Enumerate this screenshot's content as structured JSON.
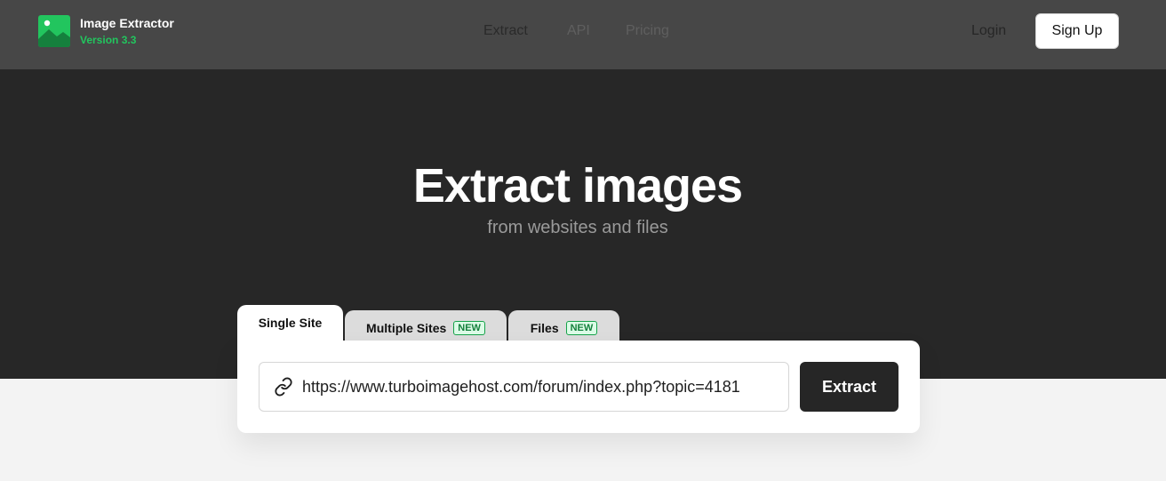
{
  "header": {
    "brand_name": "Image Extractor",
    "brand_version": "Version 3.3",
    "nav": [
      "Extract",
      "API",
      "Pricing"
    ],
    "login_label": "Login",
    "signup_label": "Sign Up"
  },
  "hero": {
    "title": "Extract images",
    "subtitle": "from websites and files"
  },
  "tabs": [
    {
      "label": "Single Site",
      "badge": "",
      "active": true
    },
    {
      "label": "Multiple Sites",
      "badge": "NEW",
      "active": false
    },
    {
      "label": "Files",
      "badge": "NEW",
      "active": false
    }
  ],
  "form": {
    "url_value": "https://www.turboimagehost.com/forum/index.php?topic=4181",
    "extract_label": "Extract"
  },
  "colors": {
    "topbar": "#474747",
    "hero": "#272727",
    "brand_accent": "#22c55e",
    "badge_green": "#16a34a"
  },
  "icons": [
    "image-icon",
    "link-icon"
  ]
}
